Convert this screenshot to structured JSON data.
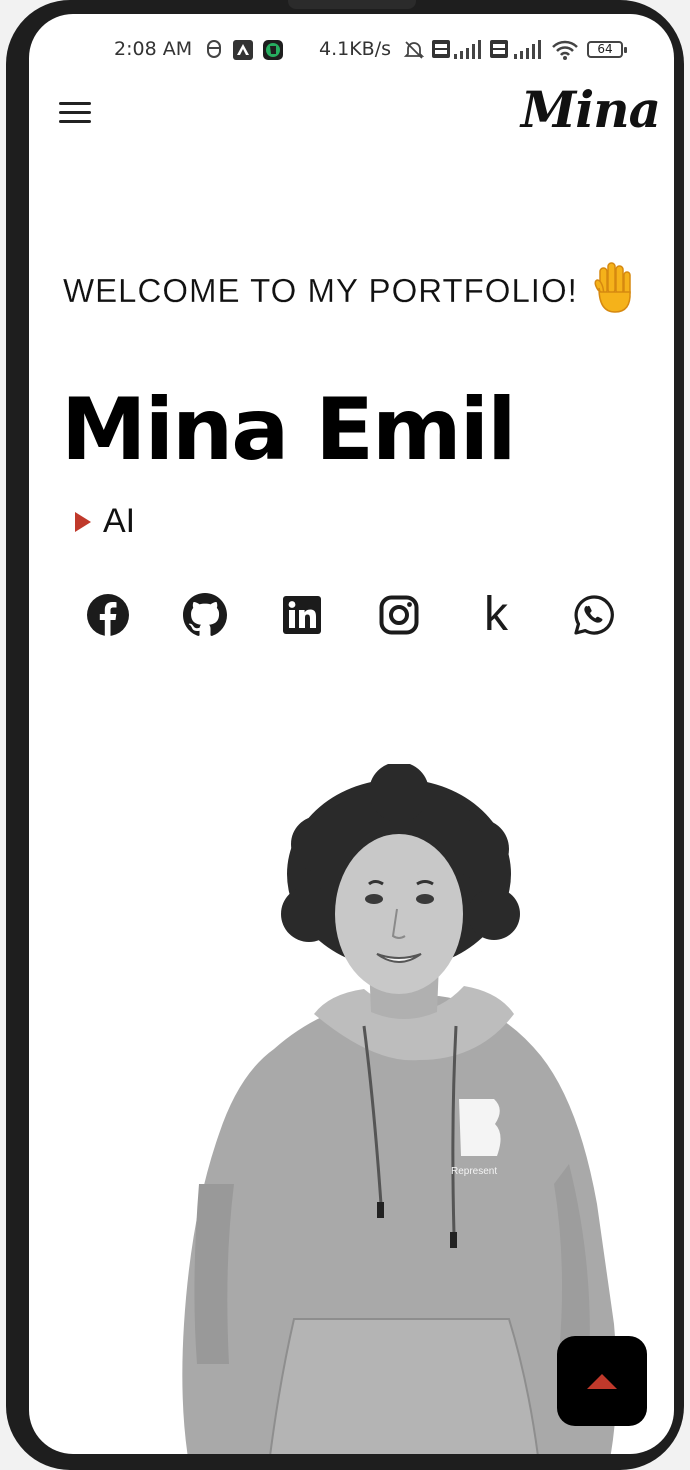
{
  "status_bar": {
    "time": "2:08 AM",
    "net_speed": "4.1KB/s",
    "battery": "64"
  },
  "app_bar": {
    "brand": "Mina"
  },
  "hero": {
    "welcome": "WELCOME TO MY PORTFOLIO!",
    "name": "Mina Emil",
    "role": "AI",
    "hoodie_print": "Represent"
  },
  "socials": [
    {
      "icon": "facebook-icon"
    },
    {
      "icon": "github-icon"
    },
    {
      "icon": "linkedin-icon"
    },
    {
      "icon": "instagram-icon"
    },
    {
      "icon": "kaggle-icon",
      "glyph": "k"
    },
    {
      "icon": "whatsapp-icon"
    }
  ],
  "colors": {
    "accent": "#c0392b",
    "text": "#111111",
    "background": "#ffffff",
    "button_bg": "#000000"
  }
}
